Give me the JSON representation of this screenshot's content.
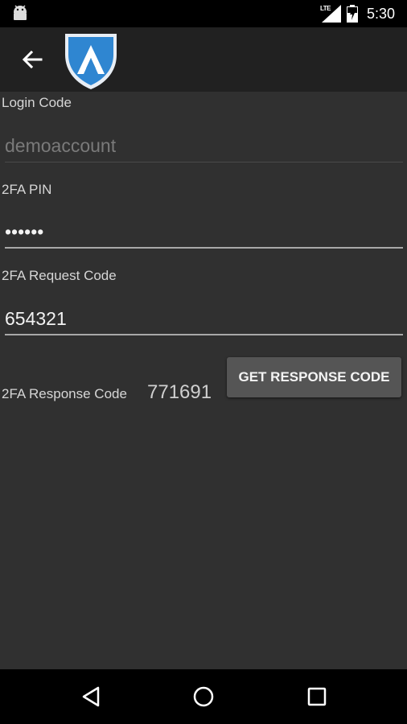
{
  "status_bar": {
    "network": "LTE",
    "time": "5:30",
    "icons": [
      "android-icon",
      "signal-icon",
      "battery-icon"
    ]
  },
  "app_bar": {
    "back_icon": "arrow-left-icon",
    "logo_icon": "shield-logo-icon"
  },
  "form": {
    "login_code": {
      "label": "Login Code",
      "value": "demoaccount"
    },
    "pin": {
      "label": "2FA PIN",
      "value": "••••••"
    },
    "request_code": {
      "label": "2FA Request Code",
      "value": "654321"
    },
    "response_code": {
      "label": "2FA Response Code",
      "value": "771691"
    },
    "get_button_label": "GET RESPONSE CODE"
  },
  "nav_bar": {
    "items": [
      "back-triangle-icon",
      "home-circle-icon",
      "recents-square-icon"
    ]
  },
  "colors": {
    "background": "#303030",
    "app_bar": "#212121",
    "logo_blue": "#2f86d1",
    "button": "#555555"
  }
}
